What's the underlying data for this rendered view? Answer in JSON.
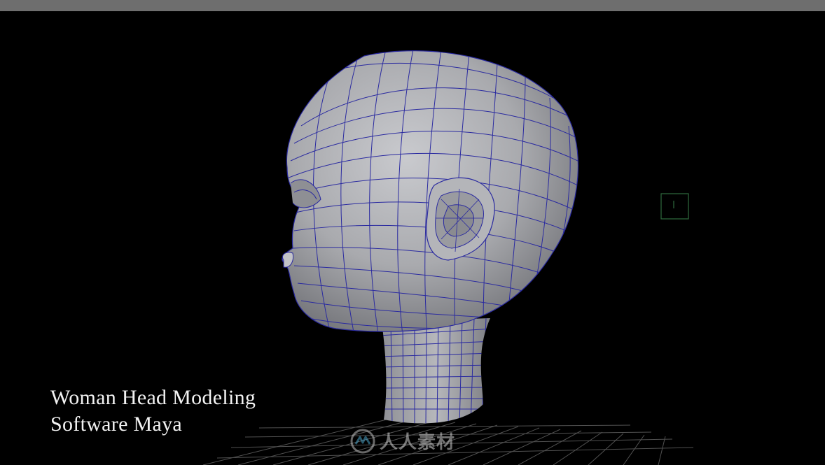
{
  "app": {
    "title_lines": [
      "Woman Head Modeling",
      "Software Maya"
    ]
  },
  "watermark": {
    "text": "人人素材",
    "icon": "rr-logo-icon"
  },
  "colors": {
    "wireframe": "#2a2aa0",
    "mesh_fill": "#a9aaae",
    "background": "#000000",
    "grid": "#5a5a5a",
    "top_bar": "#6e6e6e",
    "locator": "#2f6a3e"
  }
}
